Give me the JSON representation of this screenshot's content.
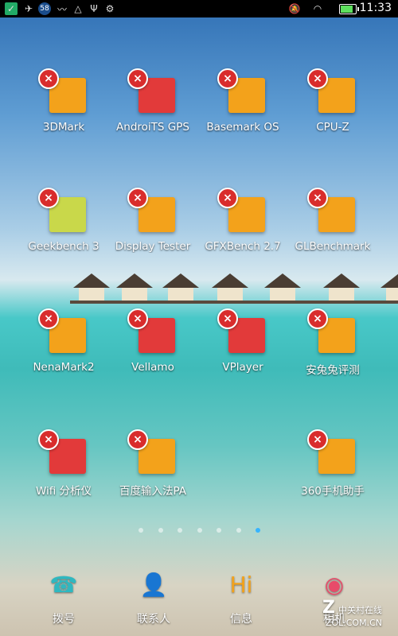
{
  "status_bar": {
    "notification_count": "58",
    "time": "11:33",
    "battery_level_fraction": 0.85
  },
  "home_screen": {
    "rows": [
      [
        {
          "label": "3DMark",
          "icon": "3dmark-icon",
          "color": "#f3a21b"
        },
        {
          "label": "AndroiTS GPS",
          "icon": "gps-icon",
          "color": "#e23a3a"
        },
        {
          "label": "Basemark OS",
          "icon": "basemark-icon",
          "color": "#f3a21b"
        },
        {
          "label": "CPU-Z",
          "icon": "cpuz-icon",
          "color": "#f3a21b"
        }
      ],
      [
        {
          "label": "Geekbench 3",
          "icon": "geekbench-icon",
          "color": "#c9d84a"
        },
        {
          "label": "Display Tester",
          "icon": "display-tester-icon",
          "color": "#f3a21b"
        },
        {
          "label": "GFXBench 2.7",
          "icon": "gfxbench-icon",
          "color": "#f3a21b"
        },
        {
          "label": "GLBenchmark",
          "icon": "glbenchmark-icon",
          "color": "#f3a21b"
        }
      ],
      [
        {
          "label": "NenaMark2",
          "icon": "nenamark-icon",
          "color": "#f3a21b"
        },
        {
          "label": "Vellamo",
          "icon": "vellamo-icon",
          "color": "#e23a3a"
        },
        {
          "label": "VPlayer",
          "icon": "vplayer-icon",
          "color": "#e23a3a"
        },
        {
          "label": "安兔兔评测",
          "icon": "antutu-icon",
          "color": "#f3a21b"
        }
      ],
      [
        {
          "label": "Wifi 分析仪",
          "icon": "wifi-analyzer-icon",
          "color": "#e23a3a"
        },
        {
          "label": "百度输入法PA",
          "icon": "baidu-ime-icon",
          "color": "#f3a21b"
        },
        null,
        {
          "label": "360手机助手",
          "icon": "360-assistant-icon",
          "color": "#f3a21b"
        }
      ]
    ],
    "remove_glyph": "×"
  },
  "pager": {
    "count": 7,
    "active_index": 6,
    "active_color": "#37b4ff"
  },
  "dock": {
    "items": [
      {
        "label": "拨号",
        "icon": "phone-icon",
        "glyph": "☎",
        "color": "#2fb8c0"
      },
      {
        "label": "联系人",
        "icon": "contacts-icon",
        "glyph": "👤",
        "color": "#7b3fa8"
      },
      {
        "label": "信息",
        "icon": "messages-icon",
        "glyph": "Hi",
        "color": "#f3a21b"
      },
      {
        "label": "相机",
        "icon": "camera-icon",
        "glyph": "◉",
        "color": "#e84b6a"
      }
    ]
  },
  "watermark": {
    "brand_cn": "中关村在线",
    "brand_url": "ZOL.COM.CN"
  }
}
